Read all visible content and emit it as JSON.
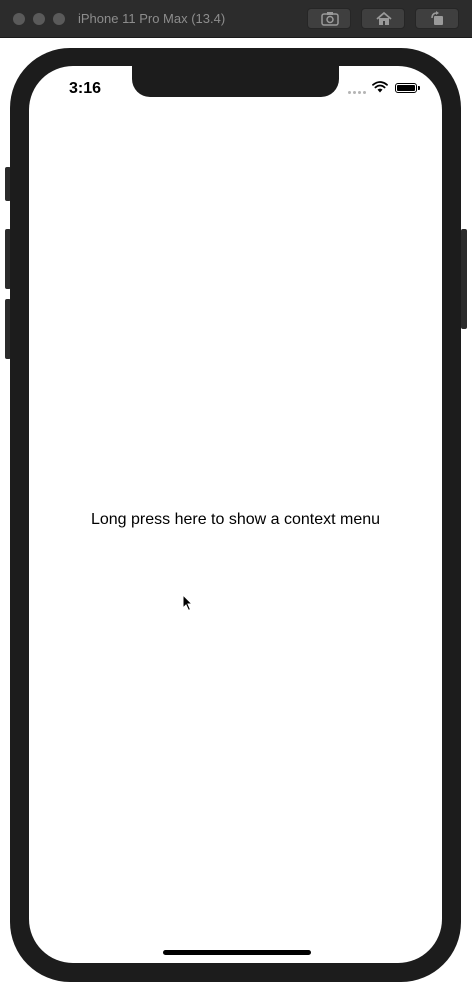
{
  "window": {
    "title": "iPhone 11 Pro Max (13.4)",
    "toolbar": {
      "screenshot_icon": "camera-icon",
      "home_icon": "home-icon",
      "rotate_icon": "rotate-icon"
    }
  },
  "status_bar": {
    "time": "3:16",
    "signal_icon": "cellular-signal-icon",
    "wifi_icon": "wifi-icon",
    "battery_icon": "battery-icon",
    "battery_level": 1.0
  },
  "content": {
    "prompt": "Long press here to show a context menu"
  },
  "colors": {
    "device_frame": "#1c1c1c",
    "titlebar": "#2c2c2c",
    "screen_bg": "#ffffff",
    "text": "#000000"
  }
}
